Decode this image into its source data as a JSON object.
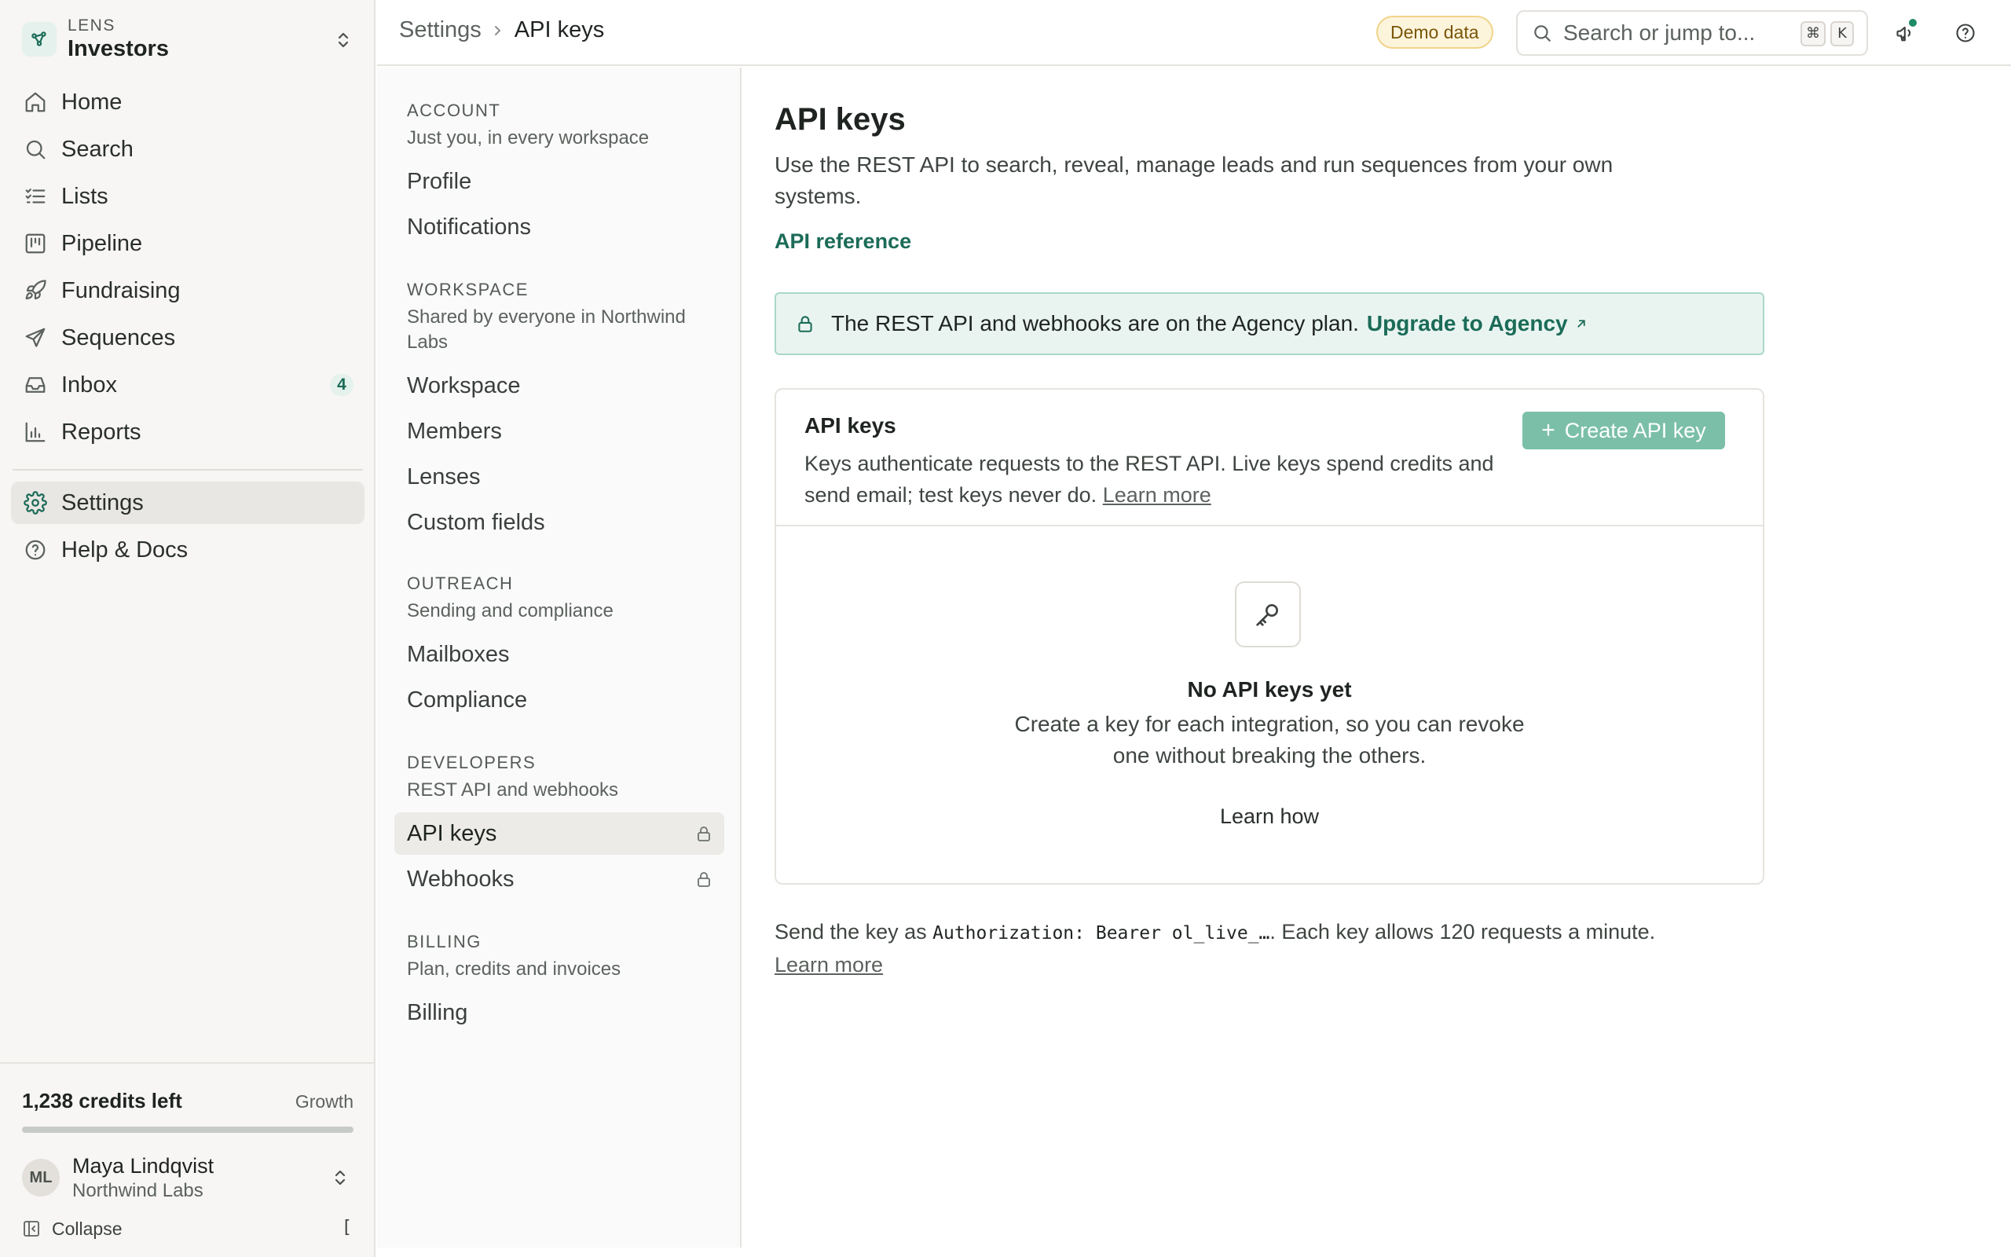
{
  "workspace": {
    "kicker": "LENS",
    "name": "Investors"
  },
  "nav": {
    "items": [
      {
        "label": "Home",
        "icon": "home-icon"
      },
      {
        "label": "Search",
        "icon": "search-icon"
      },
      {
        "label": "Lists",
        "icon": "list-icon"
      },
      {
        "label": "Pipeline",
        "icon": "kanban-icon"
      },
      {
        "label": "Fundraising",
        "icon": "rocket-icon"
      },
      {
        "label": "Sequences",
        "icon": "send-icon"
      },
      {
        "label": "Inbox",
        "icon": "inbox-icon",
        "badge": "4"
      },
      {
        "label": "Reports",
        "icon": "bar-chart-icon"
      }
    ],
    "settings": "Settings",
    "help": "Help & Docs"
  },
  "credits": {
    "label": "1,238 credits left",
    "plan": "Growth",
    "used_fraction": 1.0
  },
  "user": {
    "initials": "ML",
    "name": "Maya Lindqvist",
    "org": "Northwind Labs"
  },
  "collapse": {
    "label": "Collapse",
    "shortcut": "["
  },
  "topbar": {
    "breadcrumb_parent": "Settings",
    "breadcrumb_current": "API keys",
    "demo_badge": "Demo data",
    "search_placeholder": "Search or jump to...",
    "kbd_mod": "⌘",
    "kbd_key": "K"
  },
  "subnav": {
    "account": {
      "title": "ACCOUNT",
      "desc": "Just you, in every workspace",
      "items": [
        "Profile",
        "Notifications"
      ]
    },
    "workspace": {
      "title": "WORKSPACE",
      "desc": "Shared by everyone in Northwind Labs",
      "items": [
        "Workspace",
        "Members",
        "Lenses",
        "Custom fields"
      ]
    },
    "outreach": {
      "title": "OUTREACH",
      "desc": "Sending and compliance",
      "items": [
        "Mailboxes",
        "Compliance"
      ]
    },
    "developers": {
      "title": "DEVELOPERS",
      "desc": "REST API and webhooks",
      "items": [
        "API keys",
        "Webhooks"
      ]
    },
    "billing": {
      "title": "BILLING",
      "desc": "Plan, credits and invoices",
      "items": [
        "Billing"
      ]
    }
  },
  "main": {
    "title": "API keys",
    "description": "Use the REST API to search, reveal, manage leads and run sequences from your own systems.",
    "api_reference": "API reference",
    "banner": {
      "text": "The REST API and webhooks are on the Agency plan.",
      "link": "Upgrade to Agency"
    },
    "card": {
      "title": "API keys",
      "description": "Keys authenticate requests to the REST API. Live keys spend credits and send email; test keys never do.",
      "learn_more": "Learn more",
      "create_button": "Create API key",
      "empty_title": "No API keys yet",
      "empty_desc": "Create a key for each integration, so you can revoke one without breaking the others.",
      "empty_link": "Learn how"
    },
    "footnote": {
      "prefix": "Send the key as ",
      "code": "Authorization: Bearer ol_live_…",
      "suffix": ". Each key allows 120 requests a minute.",
      "link": "Learn more"
    }
  }
}
